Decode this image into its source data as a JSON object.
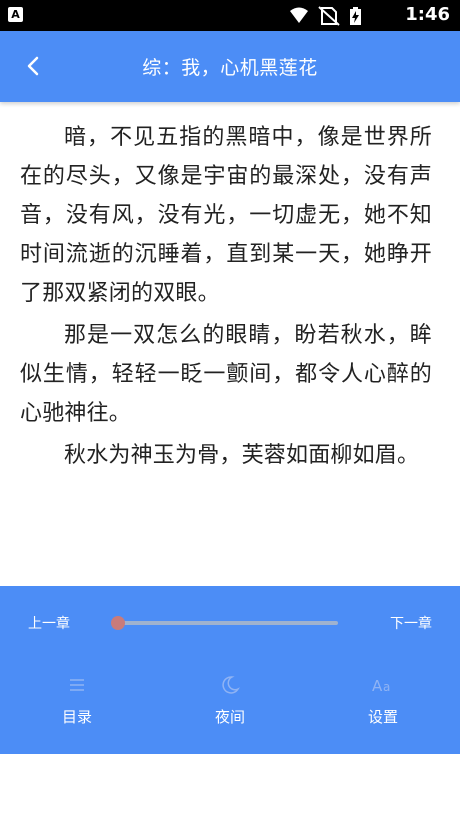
{
  "status_bar": {
    "notification_icon": "A",
    "time": "1:46",
    "icons": [
      "wifi-icon",
      "no-sim-icon",
      "battery-charging-icon"
    ]
  },
  "header": {
    "back_icon": "chevron-left-icon",
    "title": "综：我，心机黑莲花"
  },
  "content": {
    "paragraphs": [
      "暗，不见五指的黑暗中，像是世界所在的尽头，又像是宇宙的最深处，没有声音，没有风，没有光，一切虚无，她不知时间流逝的沉睡着，直到某一天，她睁开了那双紧闭的双眼。",
      "那是一双怎么的眼睛，盼若秋水，眸似生情，轻轻一眨一颤间，都令人心醉的心驰神往。",
      "秋水为神玉为骨，芙蓉如面柳如眉。"
    ]
  },
  "reader_controls": {
    "prev_chapter": "上一章",
    "next_chapter": "下一章",
    "progress": 0.0,
    "menu": [
      {
        "icon": "list-icon",
        "label": "目录"
      },
      {
        "icon": "moon-icon",
        "label": "夜间"
      },
      {
        "icon": "font-size-icon",
        "label": "设置"
      }
    ]
  },
  "colors": {
    "accent": "#4C8DF6",
    "status_bar": "#000000",
    "text": "#222222",
    "progress_thumb": "#c97b7b",
    "progress_track": "#9fb2cf"
  }
}
